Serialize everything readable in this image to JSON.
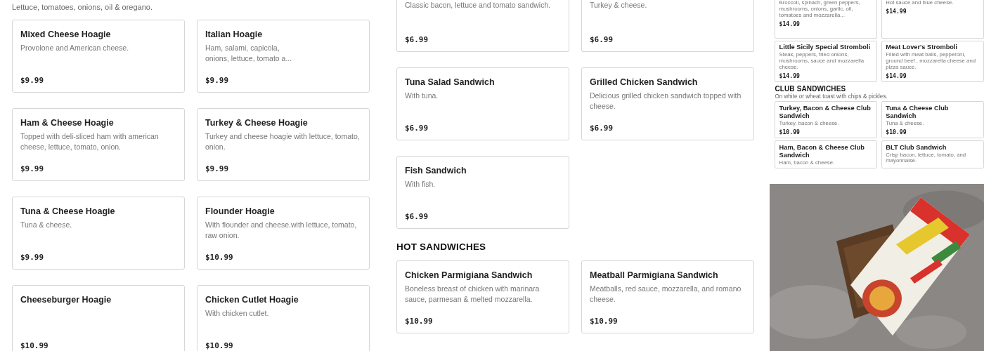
{
  "panels": [
    {
      "sections": [
        {
          "note": "Lettuce, tomatoes, onions, oil & oregano.",
          "items": [
            {
              "name": "Mixed Cheese Hoagie",
              "description": "Provolone and American cheese.",
              "price": "$9.99"
            },
            {
              "name": "Italian Hoagie",
              "description": "Ham, salami, capicola,\nonions, lettuce, tomato a...",
              "price": "$9.99"
            },
            {
              "name": "Ham & Cheese Hoagie",
              "description": "Topped with deli-sliced ham with american cheese, lettuce, tomato, onion.",
              "price": "$9.99"
            },
            {
              "name": "Turkey & Cheese Hoagie",
              "description": "Turkey and cheese hoagie with lettuce, tomato, onion.",
              "price": "$9.99"
            },
            {
              "name": "Tuna & Cheese Hoagie",
              "description": "Tuna & cheese.",
              "price": "$9.99"
            },
            {
              "name": "Flounder Hoagie",
              "description": "With flounder and cheese.with lettuce, tomato, raw onion.",
              "price": "$10.99"
            },
            {
              "name": "Cheeseburger Hoagie",
              "price": "$10.99"
            },
            {
              "name": "Chicken Cutlet Hoagie",
              "description": "With chicken cutlet.",
              "price": "$10.99"
            }
          ]
        }
      ]
    },
    {
      "sections": [
        {
          "items": [
            {
              "description": "Classic bacon, lettuce and tomato sandwich.",
              "price": "$6.99"
            },
            {
              "description": "Turkey & cheese.",
              "price": "$6.99"
            },
            {
              "name": "Tuna Salad Sandwich",
              "description": "With tuna.",
              "price": "$6.99"
            },
            {
              "name": "Grilled Chicken Sandwich",
              "description": "Delicious grilled chicken sandwich topped with cheese.",
              "price": "$6.99"
            },
            {
              "name": "Fish Sandwich",
              "description": "With fish.",
              "price": "$6.99"
            }
          ]
        },
        {
          "heading": "HOT SANDWICHES",
          "items": [
            {
              "name": "Chicken Parmigiana Sandwich",
              "description": "Boneless breast of chicken with marinara sauce, parmesan & melted mozzarella.",
              "price": "$10.99"
            },
            {
              "name": "Meatball Parmigiana Sandwich",
              "description": "Meatballs, red sauce, mozzarella, and romano cheese.",
              "price": "$10.99"
            }
          ]
        }
      ]
    },
    {
      "sections": [
        {
          "items": [
            {
              "description": "Broccoli, spinach, green peppers, mushrooms, onions, garlic, oil, tomatoes and mozzarella...",
              "price": "$14.99"
            },
            {
              "description": "Hot sauce and blue cheese.",
              "price": "$14.99"
            },
            {
              "name": "Little Sicily Special Stromboli",
              "description": "Steak, peppers, fried onions, mushrooms, sauce and mozzarella cheese.",
              "price": "$14.99"
            },
            {
              "name": "Meat Lover's Stromboli",
              "description": "Filled with meat balls, pepperoni, ground beef , mozzarella cheese and pizza sauce.",
              "price": "$14.99"
            }
          ]
        },
        {
          "heading": "CLUB SANDWICHES",
          "note": "On white or wheat toast with chips & pickles.",
          "items": [
            {
              "name": "Turkey, Bacon & Cheese Club Sandwich",
              "description": "Turkey, bacon & cheese.",
              "price": "$10.99"
            },
            {
              "name": "Tuna & Cheese Club Sandwich",
              "description": "Tuna & cheese.",
              "price": "$10.99"
            },
            {
              "name": "Ham, Bacon & Cheese Club Sandwich",
              "description": "Ham, bacon & cheese."
            },
            {
              "name": "BLT Club Sandwich",
              "description": "Crisp bacon, lettuce, tomato, and mayonnaise."
            }
          ]
        }
      ],
      "photo": {
        "kind": "picture"
      }
    }
  ]
}
